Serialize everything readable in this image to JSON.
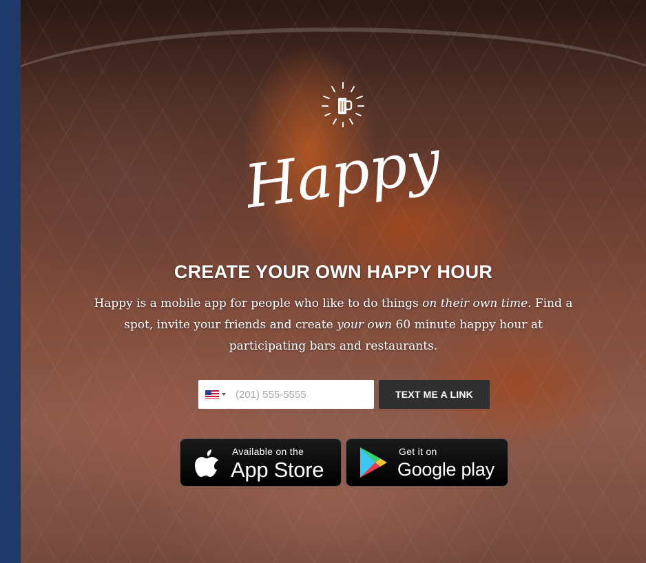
{
  "hero": {
    "logo_text": "Happy",
    "headline": "CREATE YOUR OWN HAPPY HOUR",
    "description": {
      "part1": "Happy is a mobile app for people who like to do things ",
      "emphasis1": "on their own time.",
      "part2": " Find a spot, invite your friends and create ",
      "emphasis2": "your own",
      "part3": " 60 minute happy hour at participating bars and restaurants."
    }
  },
  "phone_form": {
    "country_flag": "us-flag-icon",
    "placeholder": "(201) 555-5555",
    "button_label": "TEXT ME A LINK"
  },
  "badges": {
    "app_store": {
      "small": "Available on the",
      "large": "App Store"
    },
    "google_play": {
      "small": "Get it on",
      "large": "Google play"
    }
  },
  "colors": {
    "left_bar": "#1e3a6b",
    "button_bg": "#2f2f2f",
    "text": "#ffffff"
  }
}
